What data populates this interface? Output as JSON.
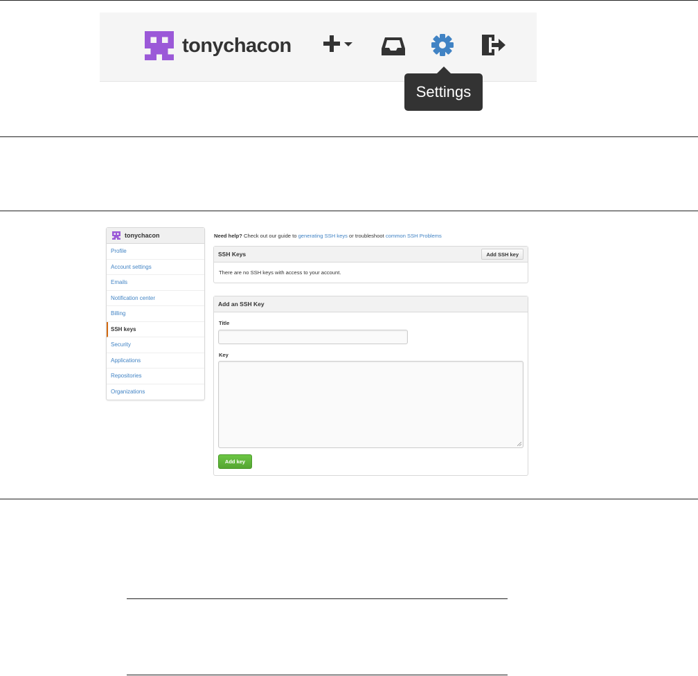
{
  "header": {
    "username": "tonychacon",
    "tooltip": "Settings",
    "icons": {
      "avatar": "identicon-avatar",
      "create": "plus-dropdown-icon",
      "notifications": "inbox-icon",
      "settings": "gear-icon",
      "signout": "sign-out-icon"
    }
  },
  "sidebar": {
    "username": "tonychacon",
    "items": [
      {
        "label": "Profile"
      },
      {
        "label": "Account settings"
      },
      {
        "label": "Emails"
      },
      {
        "label": "Notification center"
      },
      {
        "label": "Billing"
      },
      {
        "label": "SSH keys",
        "selected": true
      },
      {
        "label": "Security"
      },
      {
        "label": "Applications"
      },
      {
        "label": "Repositories"
      },
      {
        "label": "Organizations"
      }
    ]
  },
  "help": {
    "lead": "Need help?",
    "text1": " Check out our guide to ",
    "link1": "generating SSH keys",
    "text2": " or troubleshoot ",
    "link2": "common SSH Problems"
  },
  "ssh_keys": {
    "title": "SSH Keys",
    "add_button": "Add SSH key",
    "empty_message": "There are no SSH keys with access to your account."
  },
  "add_key_form": {
    "title": "Add an SSH Key",
    "title_label": "Title",
    "title_value": "",
    "key_label": "Key",
    "key_value": "",
    "submit": "Add key"
  },
  "colors": {
    "accent": "#4183c4",
    "avatar": "#9b59d8",
    "selected_marker": "#d26911",
    "submit": "#6cc644",
    "tooltip": "#333333"
  }
}
